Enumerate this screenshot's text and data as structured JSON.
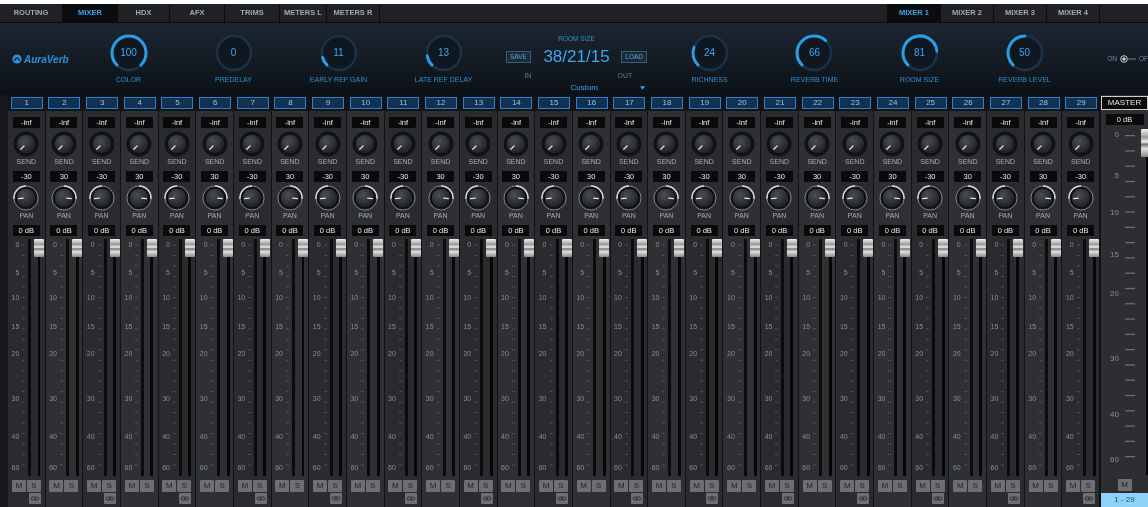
{
  "tabs": [
    {
      "label": "ROUTING",
      "selected": false
    },
    {
      "label": "MIXER",
      "selected": true
    },
    {
      "label": "HDX",
      "selected": false
    },
    {
      "label": "AFX",
      "selected": false
    },
    {
      "label": "TRIMS",
      "selected": false
    },
    {
      "label": "METERS L",
      "selected": false
    },
    {
      "label": "METERS R",
      "selected": false
    }
  ],
  "mixer_tabs": [
    {
      "label": "MIXER 1",
      "selected": true
    },
    {
      "label": "MIXER 2",
      "selected": false
    },
    {
      "label": "MIXER 3",
      "selected": false
    },
    {
      "label": "MIXER 4",
      "selected": false
    }
  ],
  "reverb": {
    "logo": "AuraVerb",
    "knobs_left": [
      {
        "value": "100",
        "label": "COLOR"
      },
      {
        "value": "0",
        "label": "PREDELAY"
      },
      {
        "value": "11",
        "label": "EARLY REF GAIN"
      },
      {
        "value": "13",
        "label": "LATE REF DELAY"
      }
    ],
    "preset": {
      "title": "ROOM SIZE",
      "value": "38/21/15",
      "save": "SAVE",
      "load": "LOAD",
      "in": "IN",
      "out": "OUT",
      "name": "Custom"
    },
    "knobs_right": [
      {
        "value": "24",
        "label": "RICHNESS"
      },
      {
        "value": "66",
        "label": "REVERB TIME"
      },
      {
        "value": "81",
        "label": "ROOM SIZE"
      },
      {
        "value": "50",
        "label": "REVERB LEVEL"
      }
    ],
    "power": {
      "on_label": "ON",
      "off_label": "OF",
      "on": true
    }
  },
  "channels": [
    {
      "number": "1",
      "send": {
        "reading": "-inf",
        "label": "SEND"
      },
      "pan": {
        "reading": "-30",
        "label": "PAN"
      },
      "fader": {
        "reading": "0 dB",
        "level": 1,
        "scale": [
          "0",
          "5",
          "10",
          "15",
          "20",
          "30",
          "40",
          "60"
        ]
      },
      "mute": "M",
      "solo": "S",
      "linked": true
    },
    {
      "number": "2",
      "send": {
        "reading": "-inf",
        "label": "SEND"
      },
      "pan": {
        "reading": "30",
        "label": "PAN"
      },
      "fader": {
        "reading": "0 dB",
        "level": 1,
        "scale": [
          "0",
          "5",
          "10",
          "15",
          "20",
          "30",
          "40",
          "60"
        ]
      },
      "mute": "M",
      "solo": "S",
      "linked": false
    },
    {
      "number": "3",
      "send": {
        "reading": "-inf",
        "label": "SEND"
      },
      "pan": {
        "reading": "-30",
        "label": "PAN"
      },
      "fader": {
        "reading": "0 dB",
        "level": 1,
        "scale": [
          "0",
          "5",
          "10",
          "15",
          "20",
          "30",
          "40",
          "60"
        ]
      },
      "mute": "M",
      "solo": "S",
      "linked": true
    },
    {
      "number": "4",
      "send": {
        "reading": "-inf",
        "label": "SEND"
      },
      "pan": {
        "reading": "30",
        "label": "PAN"
      },
      "fader": {
        "reading": "0 dB",
        "level": 1,
        "scale": [
          "0",
          "5",
          "10",
          "15",
          "20",
          "30",
          "40",
          "60"
        ]
      },
      "mute": "M",
      "solo": "S",
      "linked": false
    },
    {
      "number": "5",
      "send": {
        "reading": "-inf",
        "label": "SEND"
      },
      "pan": {
        "reading": "-30",
        "label": "PAN"
      },
      "fader": {
        "reading": "0 dB",
        "level": 1,
        "scale": [
          "0",
          "5",
          "10",
          "15",
          "20",
          "30",
          "40",
          "60"
        ]
      },
      "mute": "M",
      "solo": "S",
      "linked": true
    },
    {
      "number": "6",
      "send": {
        "reading": "-inf",
        "label": "SEND"
      },
      "pan": {
        "reading": "30",
        "label": "PAN"
      },
      "fader": {
        "reading": "0 dB",
        "level": 1,
        "scale": [
          "0",
          "5",
          "10",
          "15",
          "20",
          "30",
          "40",
          "60"
        ]
      },
      "mute": "M",
      "solo": "S",
      "linked": false
    },
    {
      "number": "7",
      "send": {
        "reading": "-inf",
        "label": "SEND"
      },
      "pan": {
        "reading": "-30",
        "label": "PAN"
      },
      "fader": {
        "reading": "0 dB",
        "level": 1,
        "scale": [
          "0",
          "5",
          "10",
          "15",
          "20",
          "30",
          "40",
          "60"
        ]
      },
      "mute": "M",
      "solo": "S",
      "linked": true
    },
    {
      "number": "8",
      "send": {
        "reading": "-inf",
        "label": "SEND"
      },
      "pan": {
        "reading": "30",
        "label": "PAN"
      },
      "fader": {
        "reading": "0 dB",
        "level": 1,
        "scale": [
          "0",
          "5",
          "10",
          "15",
          "20",
          "30",
          "40",
          "60"
        ]
      },
      "mute": "M",
      "solo": "S",
      "linked": false
    },
    {
      "number": "9",
      "send": {
        "reading": "-inf",
        "label": "SEND"
      },
      "pan": {
        "reading": "-30",
        "label": "PAN"
      },
      "fader": {
        "reading": "0 dB",
        "level": 1,
        "scale": [
          "0",
          "5",
          "10",
          "15",
          "20",
          "30",
          "40",
          "60"
        ]
      },
      "mute": "M",
      "solo": "S",
      "linked": true
    },
    {
      "number": "10",
      "send": {
        "reading": "-inf",
        "label": "SEND"
      },
      "pan": {
        "reading": "30",
        "label": "PAN"
      },
      "fader": {
        "reading": "0 dB",
        "level": 1,
        "scale": [
          "0",
          "5",
          "10",
          "15",
          "20",
          "30",
          "40",
          "60"
        ]
      },
      "mute": "M",
      "solo": "S",
      "linked": false
    },
    {
      "number": "11",
      "send": {
        "reading": "-inf",
        "label": "SEND"
      },
      "pan": {
        "reading": "-30",
        "label": "PAN"
      },
      "fader": {
        "reading": "0 dB",
        "level": 1,
        "scale": [
          "0",
          "5",
          "10",
          "15",
          "20",
          "30",
          "40",
          "60"
        ]
      },
      "mute": "M",
      "solo": "S",
      "linked": true
    },
    {
      "number": "12",
      "send": {
        "reading": "-inf",
        "label": "SEND"
      },
      "pan": {
        "reading": "30",
        "label": "PAN"
      },
      "fader": {
        "reading": "0 dB",
        "level": 1,
        "scale": [
          "0",
          "5",
          "10",
          "15",
          "20",
          "30",
          "40",
          "60"
        ]
      },
      "mute": "M",
      "solo": "S",
      "linked": false
    },
    {
      "number": "13",
      "send": {
        "reading": "-inf",
        "label": "SEND"
      },
      "pan": {
        "reading": "-30",
        "label": "PAN"
      },
      "fader": {
        "reading": "0 dB",
        "level": 1,
        "scale": [
          "0",
          "5",
          "10",
          "15",
          "20",
          "30",
          "40",
          "60"
        ]
      },
      "mute": "M",
      "solo": "S",
      "linked": true
    },
    {
      "number": "14",
      "send": {
        "reading": "-inf",
        "label": "SEND"
      },
      "pan": {
        "reading": "30",
        "label": "PAN"
      },
      "fader": {
        "reading": "0 dB",
        "level": 1,
        "scale": [
          "0",
          "5",
          "10",
          "15",
          "20",
          "30",
          "40",
          "60"
        ]
      },
      "mute": "M",
      "solo": "S",
      "linked": false
    },
    {
      "number": "15",
      "send": {
        "reading": "-inf",
        "label": "SEND"
      },
      "pan": {
        "reading": "-30",
        "label": "PAN"
      },
      "fader": {
        "reading": "0 dB",
        "level": 1,
        "scale": [
          "0",
          "5",
          "10",
          "15",
          "20",
          "30",
          "40",
          "60"
        ]
      },
      "mute": "M",
      "solo": "S",
      "linked": true
    },
    {
      "number": "16",
      "send": {
        "reading": "-inf",
        "label": "SEND"
      },
      "pan": {
        "reading": "30",
        "label": "PAN"
      },
      "fader": {
        "reading": "0 dB",
        "level": 1,
        "scale": [
          "0",
          "5",
          "10",
          "15",
          "20",
          "30",
          "40",
          "60"
        ]
      },
      "mute": "M",
      "solo": "S",
      "linked": false
    },
    {
      "number": "17",
      "send": {
        "reading": "-inf",
        "label": "SEND"
      },
      "pan": {
        "reading": "-30",
        "label": "PAN"
      },
      "fader": {
        "reading": "0 dB",
        "level": 1,
        "scale": [
          "0",
          "5",
          "10",
          "15",
          "20",
          "30",
          "40",
          "60"
        ]
      },
      "mute": "M",
      "solo": "S",
      "linked": true
    },
    {
      "number": "18",
      "send": {
        "reading": "-inf",
        "label": "SEND"
      },
      "pan": {
        "reading": "30",
        "label": "PAN"
      },
      "fader": {
        "reading": "0 dB",
        "level": 1,
        "scale": [
          "0",
          "5",
          "10",
          "15",
          "20",
          "30",
          "40",
          "60"
        ]
      },
      "mute": "M",
      "solo": "S",
      "linked": false
    },
    {
      "number": "19",
      "send": {
        "reading": "-inf",
        "label": "SEND"
      },
      "pan": {
        "reading": "-30",
        "label": "PAN"
      },
      "fader": {
        "reading": "0 dB",
        "level": 1,
        "scale": [
          "0",
          "5",
          "10",
          "15",
          "20",
          "30",
          "40",
          "60"
        ]
      },
      "mute": "M",
      "solo": "S",
      "linked": true
    },
    {
      "number": "20",
      "send": {
        "reading": "-inf",
        "label": "SEND"
      },
      "pan": {
        "reading": "30",
        "label": "PAN"
      },
      "fader": {
        "reading": "0 dB",
        "level": 1,
        "scale": [
          "0",
          "5",
          "10",
          "15",
          "20",
          "30",
          "40",
          "60"
        ]
      },
      "mute": "M",
      "solo": "S",
      "linked": false
    },
    {
      "number": "21",
      "send": {
        "reading": "-inf",
        "label": "SEND"
      },
      "pan": {
        "reading": "-30",
        "label": "PAN"
      },
      "fader": {
        "reading": "0 dB",
        "level": 1,
        "scale": [
          "0",
          "5",
          "10",
          "15",
          "20",
          "30",
          "40",
          "60"
        ]
      },
      "mute": "M",
      "solo": "S",
      "linked": true
    },
    {
      "number": "22",
      "send": {
        "reading": "-inf",
        "label": "SEND"
      },
      "pan": {
        "reading": "30",
        "label": "PAN"
      },
      "fader": {
        "reading": "0 dB",
        "level": 1,
        "scale": [
          "0",
          "5",
          "10",
          "15",
          "20",
          "30",
          "40",
          "60"
        ]
      },
      "mute": "M",
      "solo": "S",
      "linked": false
    },
    {
      "number": "23",
      "send": {
        "reading": "-inf",
        "label": "SEND"
      },
      "pan": {
        "reading": "-30",
        "label": "PAN"
      },
      "fader": {
        "reading": "0 dB",
        "level": 1,
        "scale": [
          "0",
          "5",
          "10",
          "15",
          "20",
          "30",
          "40",
          "60"
        ]
      },
      "mute": "M",
      "solo": "S",
      "linked": true
    },
    {
      "number": "24",
      "send": {
        "reading": "-inf",
        "label": "SEND"
      },
      "pan": {
        "reading": "30",
        "label": "PAN"
      },
      "fader": {
        "reading": "0 dB",
        "level": 1,
        "scale": [
          "0",
          "5",
          "10",
          "15",
          "20",
          "30",
          "40",
          "60"
        ]
      },
      "mute": "M",
      "solo": "S",
      "linked": false
    },
    {
      "number": "25",
      "send": {
        "reading": "-inf",
        "label": "SEND"
      },
      "pan": {
        "reading": "-30",
        "label": "PAN"
      },
      "fader": {
        "reading": "0 dB",
        "level": 1,
        "scale": [
          "0",
          "5",
          "10",
          "15",
          "20",
          "30",
          "40",
          "60"
        ]
      },
      "mute": "M",
      "solo": "S",
      "linked": true
    },
    {
      "number": "26",
      "send": {
        "reading": "-inf",
        "label": "SEND"
      },
      "pan": {
        "reading": "30",
        "label": "PAN"
      },
      "fader": {
        "reading": "0 dB",
        "level": 1,
        "scale": [
          "0",
          "5",
          "10",
          "15",
          "20",
          "30",
          "40",
          "60"
        ]
      },
      "mute": "M",
      "solo": "S",
      "linked": false
    },
    {
      "number": "27",
      "send": {
        "reading": "-inf",
        "label": "SEND"
      },
      "pan": {
        "reading": "-30",
        "label": "PAN"
      },
      "fader": {
        "reading": "0 dB",
        "level": 1,
        "scale": [
          "0",
          "5",
          "10",
          "15",
          "20",
          "30",
          "40",
          "60"
        ]
      },
      "mute": "M",
      "solo": "S",
      "linked": true
    },
    {
      "number": "28",
      "send": {
        "reading": "-inf",
        "label": "SEND"
      },
      "pan": {
        "reading": "30",
        "label": "PAN"
      },
      "fader": {
        "reading": "0 dB",
        "level": 1,
        "scale": [
          "0",
          "5",
          "10",
          "15",
          "20",
          "30",
          "40",
          "60"
        ]
      },
      "mute": "M",
      "solo": "S",
      "linked": false
    },
    {
      "number": "29",
      "send": {
        "reading": "-inf",
        "label": "SEND"
      },
      "pan": {
        "reading": "-30",
        "label": "PAN"
      },
      "fader": {
        "reading": "0 dB",
        "level": 1,
        "scale": [
          "0",
          "5",
          "10",
          "15",
          "20",
          "30",
          "40",
          "60"
        ]
      },
      "mute": "M",
      "solo": "S",
      "linked": true
    }
  ],
  "master": {
    "title": "MASTER",
    "fader": {
      "reading": "0 dB",
      "level": 1,
      "scale": [
        "0",
        "5",
        "10",
        "15",
        "20",
        "30",
        "40",
        "60"
      ]
    },
    "mute": "M",
    "range": "1 - 29"
  }
}
